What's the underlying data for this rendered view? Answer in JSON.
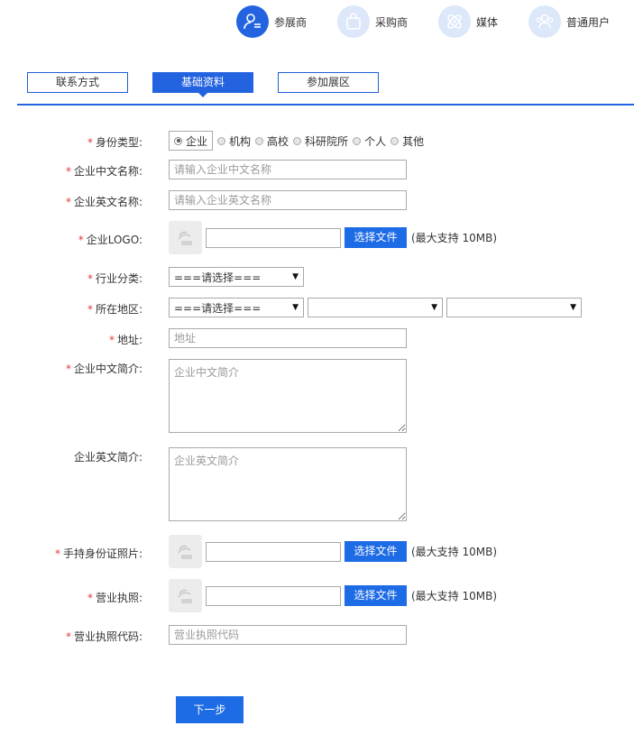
{
  "roles": [
    {
      "label": "参展商",
      "icon": "exhibitor-icon",
      "active": true
    },
    {
      "label": "采购商",
      "icon": "buyer-icon",
      "active": false
    },
    {
      "label": "媒体",
      "icon": "media-icon",
      "active": false
    },
    {
      "label": "普通用户",
      "icon": "user-group-icon",
      "active": false
    }
  ],
  "tabs": [
    "联系方式",
    "基础资料",
    "参加展区"
  ],
  "active_tab": "基础资料",
  "form": {
    "identity_type": {
      "label": "身份类型:",
      "required": "*",
      "options": [
        "企业",
        "机构",
        "高校",
        "科研院所",
        "个人",
        "其他"
      ],
      "selected": "企业"
    },
    "cn_name": {
      "label": "企业中文名称:",
      "required": "*",
      "placeholder": "请输入企业中文名称"
    },
    "en_name": {
      "label": "企业英文名称:",
      "required": "*",
      "placeholder": "请输入企业英文名称"
    },
    "logo": {
      "label": "企业LOGO:",
      "required": "*",
      "button": "选择文件",
      "hint": "(最大支持 10MB)"
    },
    "industry": {
      "label": "行业分类:",
      "required": "*",
      "value": "===请选择==="
    },
    "region": {
      "label": "所在地区:",
      "required": "*",
      "value1": "===请选择===",
      "value2": "",
      "value3": ""
    },
    "address": {
      "label": "地址:",
      "required": "*",
      "placeholder": "地址"
    },
    "cn_intro": {
      "label": "企业中文简介:",
      "required": "*",
      "placeholder": "企业中文简介"
    },
    "en_intro": {
      "label": "企业英文简介:",
      "placeholder": "企业英文简介"
    },
    "id_photo": {
      "label": "手持身份证照片:",
      "required": "*",
      "button": "选择文件",
      "hint": "(最大支持 10MB)"
    },
    "license": {
      "label": "营业执照:",
      "required": "*",
      "button": "选择文件",
      "hint": "(最大支持 10MB)"
    },
    "license_code": {
      "label": "营业执照代码:",
      "required": "*",
      "placeholder": "营业执照代码"
    }
  },
  "next_button": "下一步",
  "colors": {
    "accent": "#2463e0",
    "button": "#1e6be6",
    "required": "#e63a3a"
  }
}
